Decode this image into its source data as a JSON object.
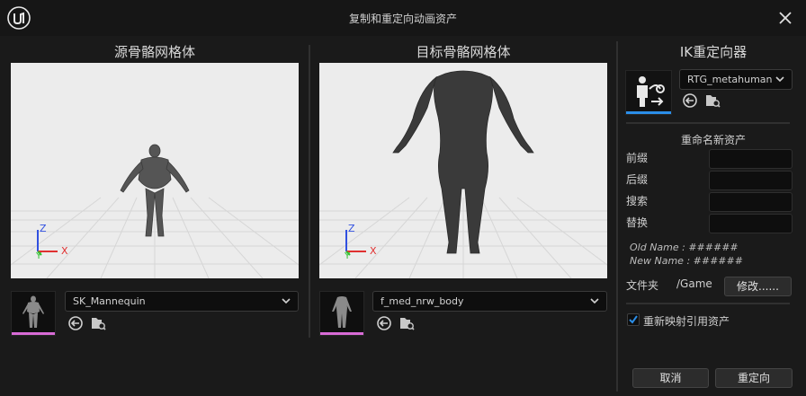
{
  "window": {
    "title": "复制和重定向动画资产"
  },
  "source": {
    "heading": "源骨骼网格体",
    "mesh_name": "SK_Mannequin",
    "axes": {
      "z": "Z",
      "y": "Y",
      "x": "X"
    }
  },
  "target": {
    "heading": "目标骨骼网格体",
    "mesh_name": "f_med_nrw_body",
    "axes": {
      "z": "Z",
      "y": "Y",
      "x": "X"
    }
  },
  "ik": {
    "heading": "IK重定向器",
    "retargeter_name": "RTG_metahuman"
  },
  "rename": {
    "heading": "重命名新资产",
    "prefix_label": "前缀",
    "suffix_label": "后缀",
    "search_label": "搜索",
    "replace_label": "替换",
    "old_name": "Old Name : ######",
    "new_name": "New Name : ######"
  },
  "folder": {
    "label": "文件夹",
    "path": "/Game",
    "modify_label": "修改......"
  },
  "options": {
    "remap_label": "重新映射引用资产",
    "remap_checked": true
  },
  "footer": {
    "cancel_label": "取消",
    "retarget_label": "重定向"
  },
  "colors": {
    "accent_blue": "#2b8ee8",
    "mesh_pink": "#d86bd6",
    "axis_x": "#e03030",
    "axis_y": "#30c030",
    "axis_z": "#3050e0"
  }
}
